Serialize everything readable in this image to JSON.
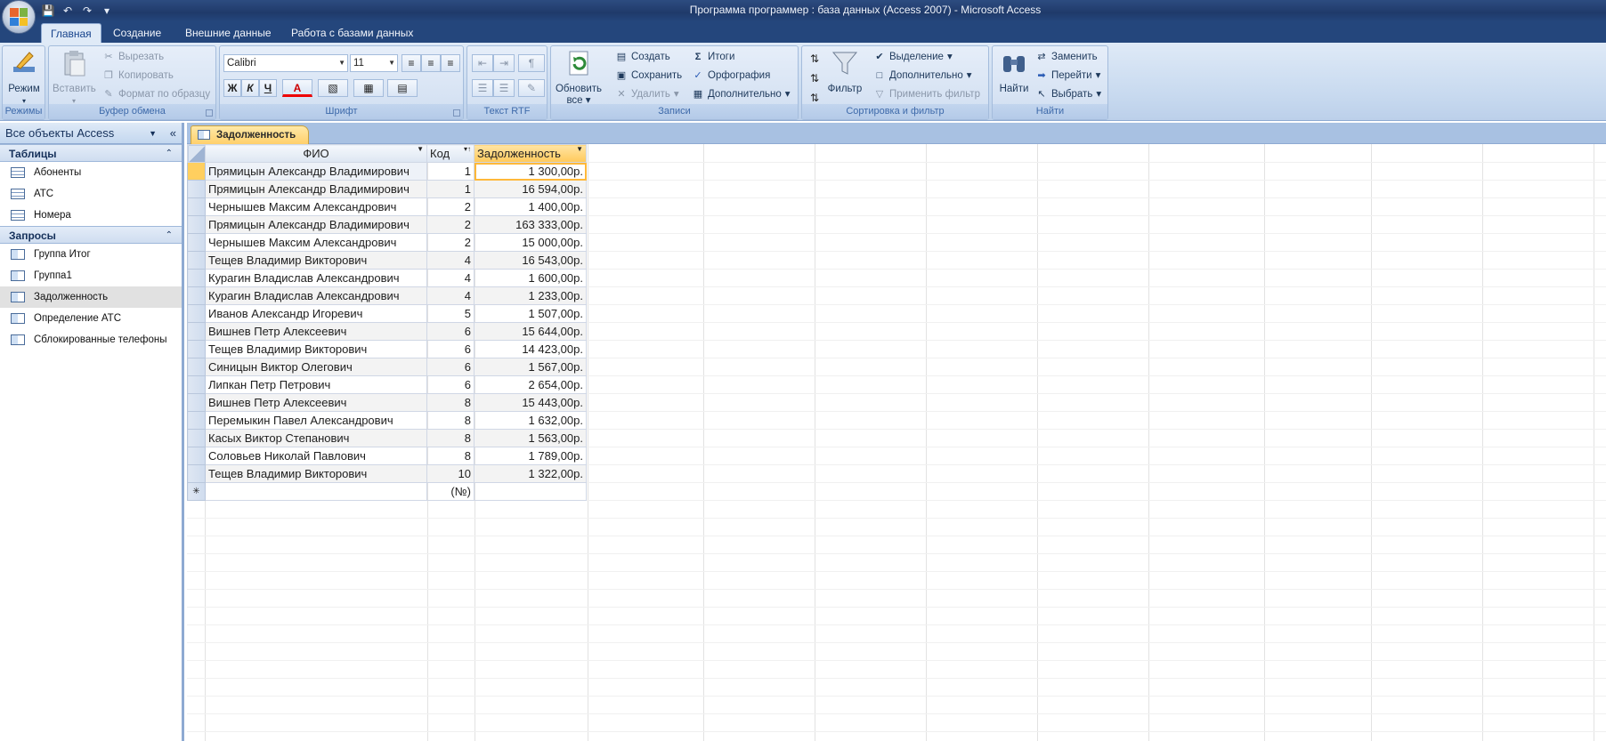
{
  "window": {
    "title": "Программа программер : база данных (Access 2007) - Microsoft Access"
  },
  "ribbon_tabs": [
    "Главная",
    "Создание",
    "Внешние данные",
    "Работа с базами данных"
  ],
  "ribbon": {
    "modes": {
      "label": "Режимы",
      "view_button": "Режим"
    },
    "clipboard": {
      "label": "Буфер обмена",
      "paste": "Вставить",
      "cut": "Вырезать",
      "copy": "Копировать",
      "format_painter": "Формат по образцу"
    },
    "font": {
      "label": "Шрифт",
      "font_name": "Calibri",
      "font_size": "11",
      "bold": "Ж",
      "italic": "К",
      "underline": "Ч",
      "font_color": "A"
    },
    "rtf": {
      "label": "Текст RTF"
    },
    "records": {
      "label": "Записи",
      "refresh": "Обновить",
      "refresh2": "все",
      "new": "Создать",
      "save": "Сохранить",
      "delete": "Удалить",
      "totals": "Итоги",
      "spelling": "Орфография",
      "more": "Дополнительно"
    },
    "sort_filter": {
      "label": "Сортировка и фильтр",
      "filter": "Фильтр",
      "selection": "Выделение",
      "advanced": "Дополнительно",
      "toggle_filter": "Применить фильтр"
    },
    "find": {
      "label": "Найти",
      "find": "Найти",
      "replace": "Заменить",
      "goto": "Перейти",
      "select": "Выбрать"
    }
  },
  "nav_pane": {
    "header": "Все объекты Access",
    "sections": [
      {
        "title": "Таблицы",
        "items": [
          "Абоненты",
          "АТС",
          "Номера"
        ]
      },
      {
        "title": "Запросы",
        "items": [
          "Группа Итог",
          "Группа1",
          "Задолженность",
          "Определение АТС",
          "Сблокированные телефоны"
        ]
      }
    ],
    "selected": "Задолженность"
  },
  "document_tab": "Задолженность",
  "datasheet": {
    "columns": [
      "ФИО",
      "Код",
      "Задолженность"
    ],
    "rows": [
      [
        "Прямицын Александр Владимирович",
        "1",
        "1 300,00р."
      ],
      [
        "Прямицын Александр Владимирович",
        "1",
        "16 594,00р."
      ],
      [
        "Чернышев Максим Александрович",
        "2",
        "1 400,00р."
      ],
      [
        "Прямицын Александр Владимирович",
        "2",
        "163 333,00р."
      ],
      [
        "Чернышев Максим Александрович",
        "2",
        "15 000,00р."
      ],
      [
        "Тещев Владимир Викторович",
        "4",
        "16 543,00р."
      ],
      [
        "Курагин Владислав Александрович",
        "4",
        "1 600,00р."
      ],
      [
        "Курагин Владислав Александрович",
        "4",
        "1 233,00р."
      ],
      [
        "Иванов Александр Игоревич",
        "5",
        "1 507,00р."
      ],
      [
        "Вишнев Петр Алексеевич",
        "6",
        "15 644,00р."
      ],
      [
        "Тещев Владимир Викторович",
        "6",
        "14 423,00р."
      ],
      [
        "Синицын Виктор Олегович",
        "6",
        "1 567,00р."
      ],
      [
        "Липкан Петр Петрович",
        "6",
        "2 654,00р."
      ],
      [
        "Вишнев Петр Алексеевич",
        "8",
        "15 443,00р."
      ],
      [
        "Перемыкин Павел Александрович",
        "8",
        "1 632,00р."
      ],
      [
        "Касых Виктор Степанович",
        "8",
        "1 563,00р."
      ],
      [
        "Соловьев Николай Павлович",
        "8",
        "1 789,00р."
      ],
      [
        "Тещев Владимир Викторович",
        "10",
        "1 322,00р."
      ]
    ],
    "new_row_placeholder": "(№)"
  }
}
